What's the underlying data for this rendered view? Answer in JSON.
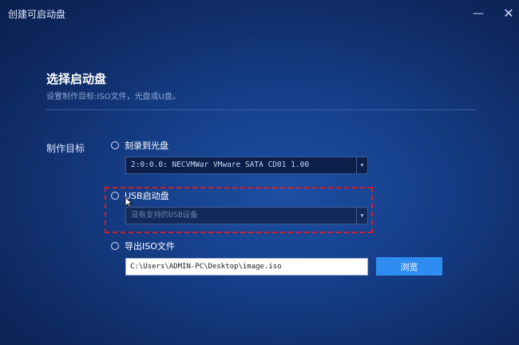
{
  "window": {
    "title": "创建可启动盘",
    "min_glyph": "—",
    "close_glyph": "✕"
  },
  "page": {
    "heading": "选择启动盘",
    "subheading": "设置制作目标:ISO文件，光盘或U盘。"
  },
  "target": {
    "label": "制作目标",
    "options": [
      {
        "label": "刻录到光盘",
        "selected": false,
        "dropdown_value": "2:0:0.0: NECVMWar VMware SATA CD01 1.00"
      },
      {
        "label": "USB启动盘",
        "selected": false,
        "dropdown_value": "没有支持的USB设备"
      },
      {
        "label": "导出ISO文件",
        "selected": false,
        "path_value": "C:\\Users\\ADMIN-PC\\Desktop\\image.iso",
        "browse_label": "浏览"
      }
    ]
  },
  "icons": {
    "dropdown": "chevron-down-icon",
    "cursor": "mouse-pointer-icon"
  },
  "colors": {
    "highlight": "#d1202a",
    "accent": "#2f8cf0",
    "background": "#163f8a"
  }
}
